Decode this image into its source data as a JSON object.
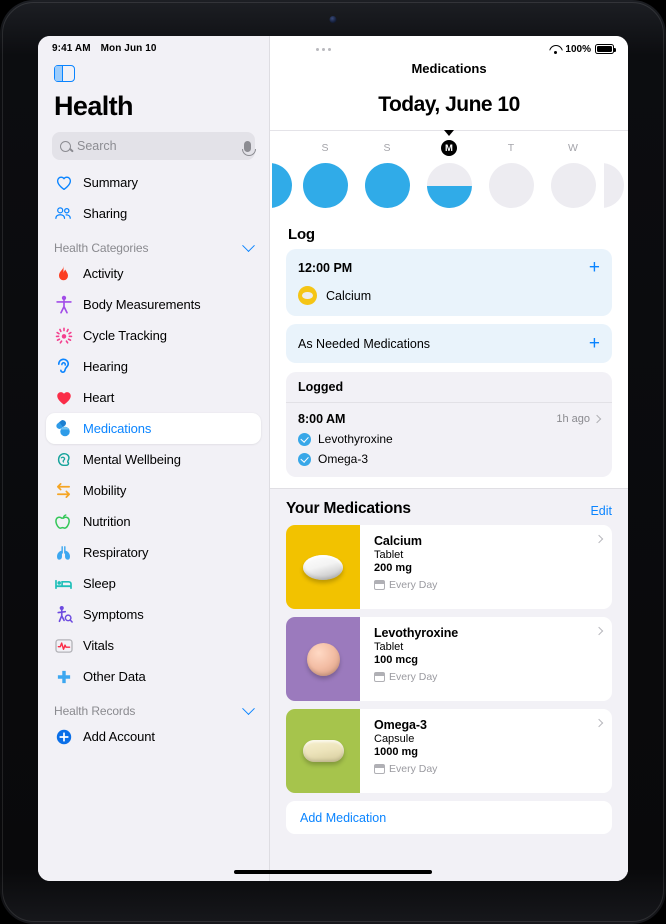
{
  "status_bar": {
    "time": "9:41 AM",
    "date": "Mon Jun 10",
    "wifi_icon": "wifi-icon",
    "battery_percent": "100%",
    "battery_icon": "battery-full-icon",
    "more_icon": "more-dots-icon"
  },
  "sidebar": {
    "toggle_icon": "sidebar-toggle-icon",
    "title": "Health",
    "search": {
      "placeholder": "Search",
      "value": "",
      "search_icon": "search-icon",
      "mic_icon": "microphone-icon"
    },
    "primary_items": [
      {
        "label": "Summary",
        "icon": "heart-outline-icon"
      },
      {
        "label": "Sharing",
        "icon": "people-icon"
      }
    ],
    "categories_section": {
      "label": "Health Categories",
      "chevron_icon": "chevron-down-icon"
    },
    "category_items": [
      {
        "label": "Activity",
        "icon": "flame-icon"
      },
      {
        "label": "Body Measurements",
        "icon": "body-figure-icon"
      },
      {
        "label": "Cycle Tracking",
        "icon": "cycle-burst-icon"
      },
      {
        "label": "Hearing",
        "icon": "ear-icon"
      },
      {
        "label": "Heart",
        "icon": "heart-filled-icon"
      },
      {
        "label": "Medications",
        "icon": "pills-icon"
      },
      {
        "label": "Mental Wellbeing",
        "icon": "brain-head-icon"
      },
      {
        "label": "Mobility",
        "icon": "arrows-mobility-icon"
      },
      {
        "label": "Nutrition",
        "icon": "apple-icon"
      },
      {
        "label": "Respiratory",
        "icon": "lungs-icon"
      },
      {
        "label": "Sleep",
        "icon": "bed-icon"
      },
      {
        "label": "Symptoms",
        "icon": "symptoms-person-icon"
      },
      {
        "label": "Vitals",
        "icon": "waveform-icon"
      },
      {
        "label": "Other Data",
        "icon": "plus-cross-icon"
      }
    ],
    "selected_item": "Medications",
    "records_section": {
      "label": "Health Records",
      "chevron_icon": "chevron-down-icon"
    },
    "add_account": {
      "label": "Add Account",
      "icon": "plus-circle-icon"
    }
  },
  "main": {
    "nav_title": "Medications",
    "date_heading": "Today, June 10",
    "caret_icon": "caret-down-icon",
    "week": [
      {
        "label": "",
        "fill": "full",
        "today": false,
        "edge": true
      },
      {
        "label": "S",
        "fill": "full",
        "today": false,
        "edge": false
      },
      {
        "label": "S",
        "fill": "full",
        "today": false,
        "edge": false
      },
      {
        "label": "M",
        "fill": "half",
        "today": true,
        "edge": false
      },
      {
        "label": "T",
        "fill": "empty",
        "today": false,
        "edge": false
      },
      {
        "label": "W",
        "fill": "empty",
        "today": false,
        "edge": false
      },
      {
        "label": "",
        "fill": "empty",
        "today": false,
        "edge": true
      }
    ],
    "log": {
      "heading": "Log",
      "scheduled": {
        "time": "12:00 PM",
        "add_icon": "plus-icon",
        "medication": "Calcium",
        "pill_icon": "yellow-tablet-icon"
      },
      "as_needed": {
        "label": "As Needed Medications",
        "add_icon": "plus-icon"
      }
    },
    "logged": {
      "heading": "Logged",
      "time": "8:00 AM",
      "relative_time": "1h ago",
      "chevron_icon": "chevron-right-icon",
      "items": [
        {
          "name": "Levothyroxine",
          "icon": "check-circle-icon"
        },
        {
          "name": "Omega-3",
          "icon": "check-circle-icon"
        }
      ]
    },
    "your_medications": {
      "heading": "Your Medications",
      "edit_label": "Edit",
      "items": [
        {
          "name": "Calcium",
          "form": "Tablet",
          "dose": "200 mg",
          "schedule": "Every Day",
          "schedule_icon": "calendar-icon",
          "chevron_icon": "chevron-right-icon",
          "tile_color": "#F2C200",
          "pill_shape": "tablet-white"
        },
        {
          "name": "Levothyroxine",
          "form": "Tablet",
          "dose": "100 mcg",
          "schedule": "Every Day",
          "schedule_icon": "calendar-icon",
          "chevron_icon": "chevron-right-icon",
          "tile_color": "#9B7ABD",
          "pill_shape": "round-peach"
        },
        {
          "name": "Omega-3",
          "form": "Capsule",
          "dose": "1000 mg",
          "schedule": "Every Day",
          "schedule_icon": "calendar-icon",
          "chevron_icon": "chevron-right-icon",
          "tile_color": "#A6C44C",
          "pill_shape": "capsule-cream"
        }
      ],
      "add_medication_label": "Add Medication"
    }
  },
  "colors": {
    "accent_blue": "#0A84FF",
    "ring_blue": "#30ABE8",
    "log_card_blue": "#E9F3FB",
    "surface_gray": "#F2F1F6"
  }
}
